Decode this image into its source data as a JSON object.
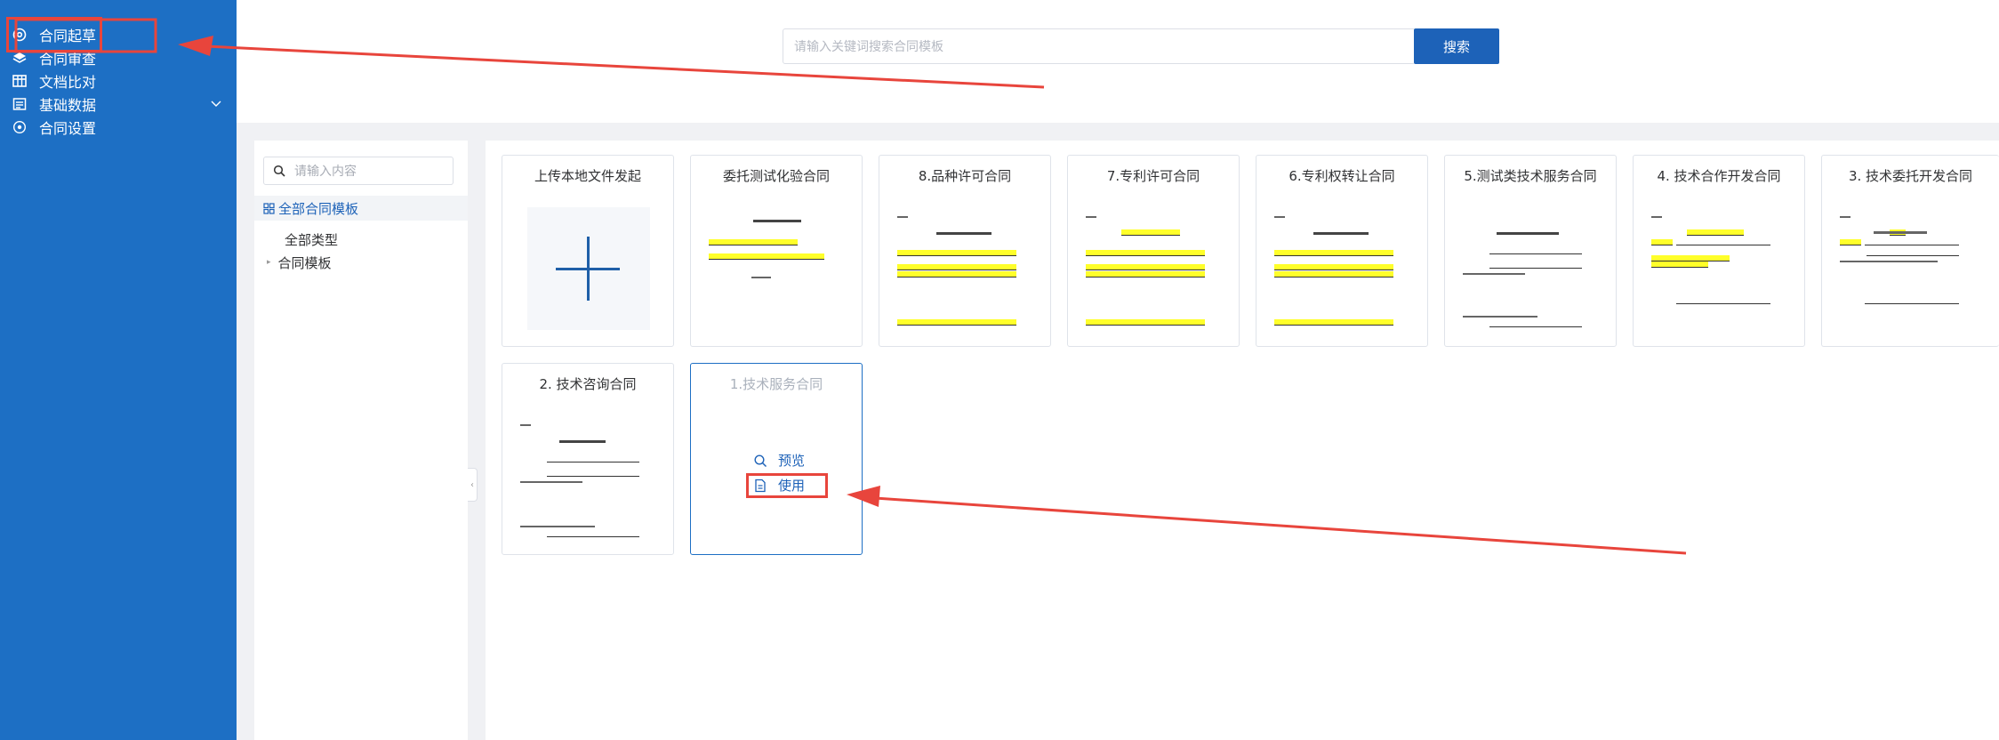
{
  "sidebar": {
    "items": [
      {
        "label": "合同起草",
        "icon": "at-sign-icon"
      },
      {
        "label": "合同审查",
        "icon": "layers-icon"
      },
      {
        "label": "文档比对",
        "icon": "table-icon"
      },
      {
        "label": "基础数据",
        "icon": "list-icon"
      },
      {
        "label": "合同设置",
        "icon": "circle-dot-icon"
      }
    ]
  },
  "header": {
    "search_placeholder": "请输入关键词搜索合同模板",
    "search_button": "搜索"
  },
  "tree": {
    "search_placeholder": "请输入内容",
    "root_label": "全部合同模板",
    "nodes": [
      "全部类型",
      "合同模板"
    ]
  },
  "templates": {
    "upload_label": "上传本地文件发起",
    "cards": [
      "委托测试化验合同",
      "8.品种许可合同",
      "7.专利许可合同",
      "6.专利权转让合同",
      "5.测试类技术服务合同",
      "4. 技术合作开发合同",
      "3. 技术委托开发合同",
      "2. 技术咨询合同",
      "1.技术服务合同"
    ],
    "actions": {
      "preview": "预览",
      "use": "使用"
    }
  },
  "colors": {
    "sidebar": "#1d6fc4",
    "accent": "#1d62b8",
    "annotation": "#e8453c",
    "highlight": "#ffff2a"
  }
}
